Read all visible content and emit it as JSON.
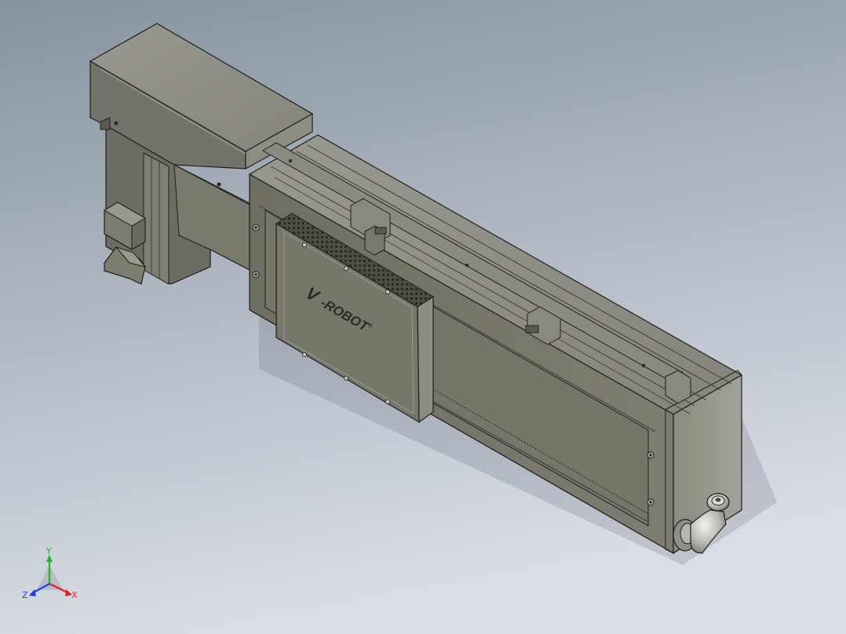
{
  "model": {
    "brand_prefix": "V",
    "brand_name": "-ROBOT",
    "brand_mark": "®"
  },
  "triad": {
    "x_label": "X",
    "y_label": "Y",
    "z_label": "Z"
  },
  "colors": {
    "background_top": "#8d99a8",
    "background_bottom": "#d9dde3",
    "body": "#7c7b6e",
    "body_light": "#94938a",
    "body_dark": "#5f5e55",
    "edge": "#1f1f1c",
    "axis_x": "#e0201c",
    "axis_y": "#26b026",
    "axis_z": "#2040e0"
  }
}
